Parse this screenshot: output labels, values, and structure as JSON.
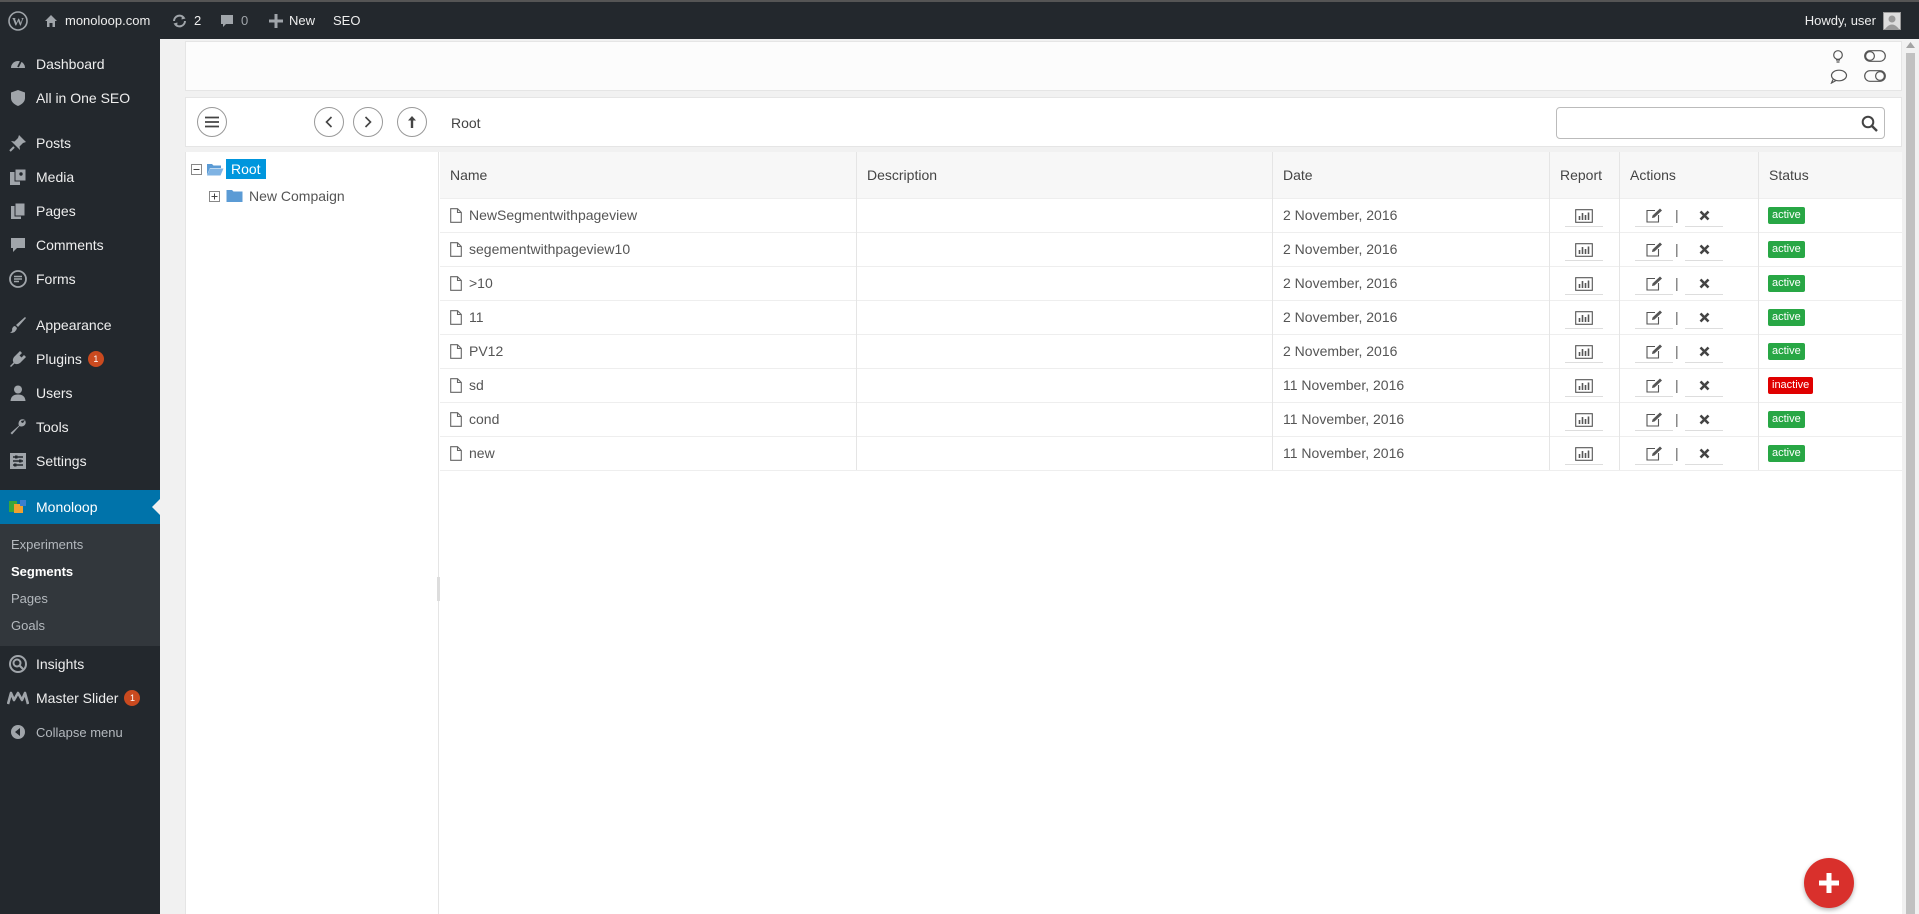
{
  "adminbar": {
    "site_name": "monoloop.com",
    "updates_count": "2",
    "comments_count": "0",
    "new_label": "New",
    "seo_label": "SEO",
    "howdy": "Howdy, user"
  },
  "sidebar": {
    "items": [
      {
        "label": "Dashboard",
        "icon": "dashboard-icon"
      },
      {
        "label": "All in One SEO",
        "icon": "shield-icon"
      },
      {
        "label": "Posts",
        "icon": "pin-icon"
      },
      {
        "label": "Media",
        "icon": "media-icon"
      },
      {
        "label": "Pages",
        "icon": "pages-icon"
      },
      {
        "label": "Comments",
        "icon": "comment-icon"
      },
      {
        "label": "Forms",
        "icon": "forms-icon"
      },
      {
        "label": "Appearance",
        "icon": "brush-icon"
      },
      {
        "label": "Plugins",
        "icon": "plugin-icon",
        "badge": "1"
      },
      {
        "label": "Users",
        "icon": "user-icon"
      },
      {
        "label": "Tools",
        "icon": "wrench-icon"
      },
      {
        "label": "Settings",
        "icon": "settings-icon"
      },
      {
        "label": "Monoloop",
        "icon": "monoloop-icon"
      },
      {
        "label": "Insights",
        "icon": "insights-icon"
      },
      {
        "label": "Master Slider",
        "icon": "master-slider-icon",
        "badge": "1"
      }
    ],
    "submenu": [
      {
        "label": "Experiments"
      },
      {
        "label": "Segments"
      },
      {
        "label": "Pages"
      },
      {
        "label": "Goals"
      }
    ],
    "collapse_label": "Collapse menu"
  },
  "toolbar": {
    "breadcrumb": "Root",
    "search_placeholder": "",
    "search_value": ""
  },
  "tree": {
    "root_label": "Root",
    "children": [
      {
        "label": "New Compaign"
      }
    ]
  },
  "table": {
    "columns": [
      "Name",
      "Description",
      "Date",
      "Report",
      "Actions",
      "Status"
    ],
    "rows": [
      {
        "name": "NewSegmentwithpageview",
        "description": "",
        "date": "2 November, 2016",
        "status": "active"
      },
      {
        "name": "segementwithpageview10",
        "description": "",
        "date": "2 November, 2016",
        "status": "active"
      },
      {
        "name": ">10",
        "description": "",
        "date": "2 November, 2016",
        "status": "active"
      },
      {
        "name": "11",
        "description": "",
        "date": "2 November, 2016",
        "status": "active"
      },
      {
        "name": "PV12",
        "description": "",
        "date": "2 November, 2016",
        "status": "active"
      },
      {
        "name": "sd",
        "description": "",
        "date": "11 November, 2016",
        "status": "inactive"
      },
      {
        "name": "cond",
        "description": "",
        "date": "11 November, 2016",
        "status": "active"
      },
      {
        "name": "new",
        "description": "",
        "date": "11 November, 2016",
        "status": "active"
      }
    ],
    "action_separator": "|"
  },
  "colors": {
    "adminbar_bg": "#23282d",
    "accent": "#0073aa",
    "tree_selected": "#0096dd",
    "status_active": "#28a745",
    "status_inactive": "#e00000",
    "fab": "#d9302c"
  }
}
